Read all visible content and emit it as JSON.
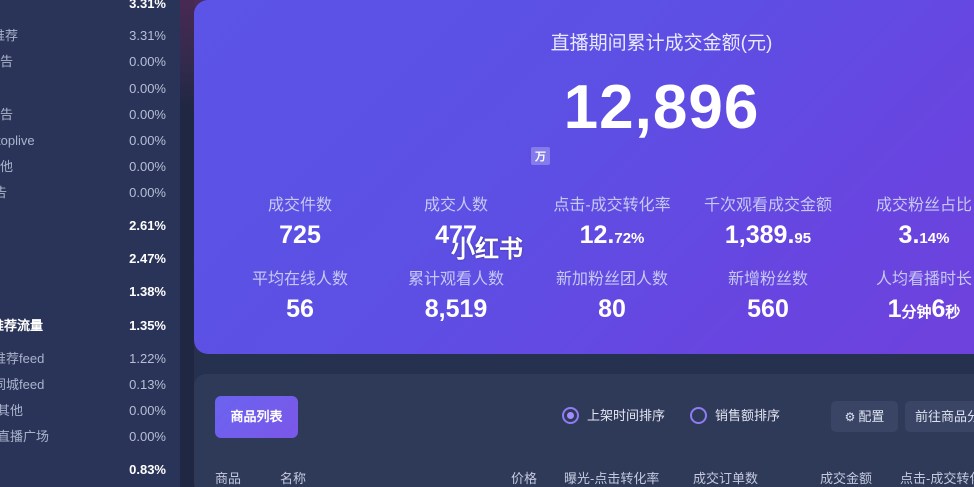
{
  "sidebar": {
    "rows": [
      {
        "label": "",
        "value": "3.31%",
        "style": "vonly"
      },
      {
        "label": "推荐",
        "value": "3.31%",
        "style": "sub",
        "shown": "′推"
      },
      {
        "label": "广告",
        "value": "0.00%",
        "style": "sub"
      },
      {
        "label": "",
        "value": "0.00%",
        "style": "sub"
      },
      {
        "label": "广告",
        "value": "0.00%",
        "style": "sub"
      },
      {
        "label": "toplive",
        "value": "0.00%",
        "style": "sub"
      },
      {
        "label": "其他",
        "value": "0.00%",
        "style": "sub"
      },
      {
        "label": "告",
        "value": "0.00%",
        "style": "sub"
      },
      {
        "label": "",
        "value": "2.61%",
        "style": "vonly"
      },
      {
        "label": "",
        "value": "2.47%",
        "style": "vonly"
      },
      {
        "label": "",
        "value": "1.38%",
        "style": "vonly"
      },
      {
        "label": "推荐流量",
        "value": "1.35%",
        "style": "main"
      },
      {
        "label": "推荐feed",
        "value": "1.22%",
        "style": "sub"
      },
      {
        "label": "同城feed",
        "value": "0.13%",
        "style": "sub"
      },
      {
        "label": "其他",
        "value": "0.00%",
        "style": "sub"
      },
      {
        "label": "直播广场",
        "value": "0.00%",
        "style": "sub"
      },
      {
        "label": "",
        "value": "0.83%",
        "style": "vonly"
      }
    ]
  },
  "hero": {
    "title": "直播期间累计成交金额(元)",
    "value": "12,896",
    "unit": "万",
    "watermark": "小红书",
    "metrics": [
      {
        "label": "成交件数",
        "int": "725",
        "frac": ""
      },
      {
        "label": "成交人数",
        "int": "477",
        "frac": ""
      },
      {
        "label": "点击-成交转化率",
        "int": "12.",
        "frac": "72%"
      },
      {
        "label": "千次观看成交金额",
        "int": "1,389.",
        "frac": "95"
      },
      {
        "label": "成交粉丝占比",
        "int": "3.",
        "frac": "14%"
      },
      {
        "label": "平均在线人数",
        "int": "56",
        "frac": ""
      },
      {
        "label": "累计观看人数",
        "int": "8,519",
        "frac": ""
      },
      {
        "label": "新加粉丝团人数",
        "int": "80",
        "frac": ""
      },
      {
        "label": "新增粉丝数",
        "int": "560",
        "frac": ""
      },
      {
        "label": "人均看播时长",
        "int": "1",
        "frac": "分钟",
        "int2": "6",
        "frac2": "秒"
      }
    ]
  },
  "products": {
    "list_button": "商品列表",
    "sort_by_time": "上架时间排序",
    "sort_by_sales": "销售额排序",
    "config_button": "配置",
    "goto_button": "前往商品分析",
    "columns": [
      "商品",
      "名称",
      "价格",
      "曝光-点击转化率",
      "成交订单数",
      "成交金额",
      "点击-成交转化率"
    ]
  },
  "colors": {
    "background": "#26304f",
    "sidebar": "#2a3458",
    "hero_start": "#5b54e6",
    "hero_end": "#6f41dc",
    "accent": "#8d7cf4"
  }
}
